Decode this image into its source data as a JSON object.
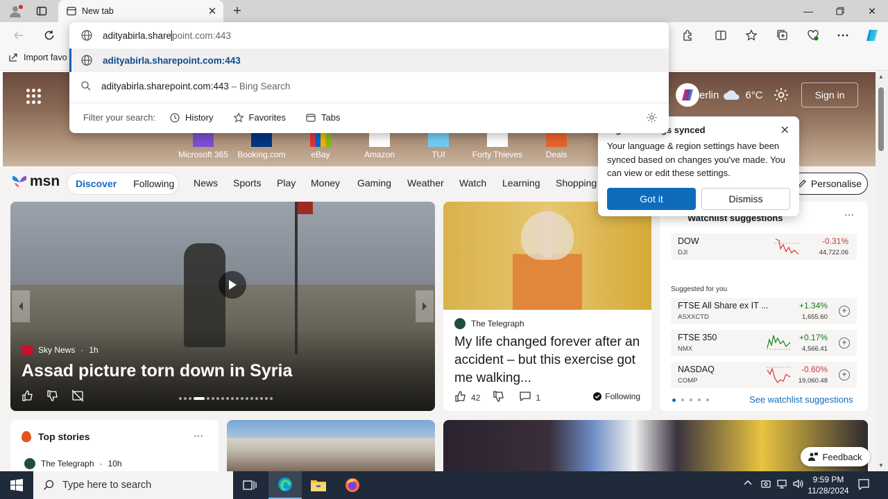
{
  "browser": {
    "tab_title": "New tab",
    "address_value": "adityabirla.share",
    "address_value_tail": "point.com:443",
    "favbar_import": "Import favo",
    "suggestions": [
      {
        "text": "adityabirla.sharepoint.com:443",
        "suffix": ""
      },
      {
        "text": "adityabirla.sharepoint.com:443",
        "suffix": " – Bing Search"
      }
    ],
    "filter_label": "Filter your search:",
    "filters": [
      "History",
      "Favorites",
      "Tabs"
    ]
  },
  "hero": {
    "weather_city": "Berlin",
    "weather_temp": "6°C",
    "sign_in": "Sign in",
    "quicklinks": [
      {
        "label": "Microsoft 365",
        "color": "#7b4fd1"
      },
      {
        "label": "Booking.com",
        "color": "#003580"
      },
      {
        "label": "eBay",
        "color": "#e53238"
      },
      {
        "label": "Amazon",
        "color": "#ffffff"
      },
      {
        "label": "TUI",
        "color": "#70cbf4"
      },
      {
        "label": "Forty Thieves",
        "color": "#ffffff"
      },
      {
        "label": "Deals",
        "color": "#e8622a"
      }
    ]
  },
  "msn": {
    "logo": "msn",
    "pill": [
      "Discover",
      "Following"
    ],
    "nav": [
      "News",
      "Sports",
      "Play",
      "Money",
      "Gaming",
      "Weather",
      "Watch",
      "Learning",
      "Shopping"
    ],
    "personalise": "Personalise"
  },
  "popup": {
    "title": "Language & region settings synced",
    "title_visible": "region settings synced",
    "body": "Your language & region settings have been synced based on changes you've made. You can view or edit these settings.",
    "got_it": "Got it",
    "dismiss": "Dismiss"
  },
  "main_story": {
    "source": "Sky News",
    "age": "1h",
    "headline": "Assad picture torn down in Syria"
  },
  "story2": {
    "source": "The Telegraph",
    "headline": "My life changed forever after an accident – but this exercise got me walking...",
    "likes": "42",
    "comments": "1",
    "following": "Following"
  },
  "watchlist": {
    "title": "Watchlist suggestions",
    "suggested_label": "Suggested for you",
    "see_more": "See watchlist suggestions",
    "stocks": [
      {
        "name": "DOW",
        "ticker": "DJI",
        "change": "-0.31%",
        "price": "44,722.06",
        "color": "#d13438",
        "addable": false
      },
      {
        "name": "FTSE All Share ex IT ...",
        "ticker": "ASXXCTD",
        "change": "+1.34%",
        "price": "1,655.60",
        "color": "#107c10",
        "addable": true
      },
      {
        "name": "FTSE 350",
        "ticker": "NMX",
        "change": "+0.17%",
        "price": "4,566.41",
        "color": "#107c10",
        "addable": true
      },
      {
        "name": "NASDAQ",
        "ticker": "COMP",
        "change": "-0.60%",
        "price": "19,060.48",
        "color": "#d13438",
        "addable": true
      }
    ]
  },
  "top_stories": {
    "title": "Top stories",
    "source": "The Telegraph",
    "age": "10h"
  },
  "feedback": "Feedback",
  "taskbar": {
    "search_placeholder": "Type here to search",
    "time": "9:59 PM",
    "date": "11/28/2024"
  }
}
